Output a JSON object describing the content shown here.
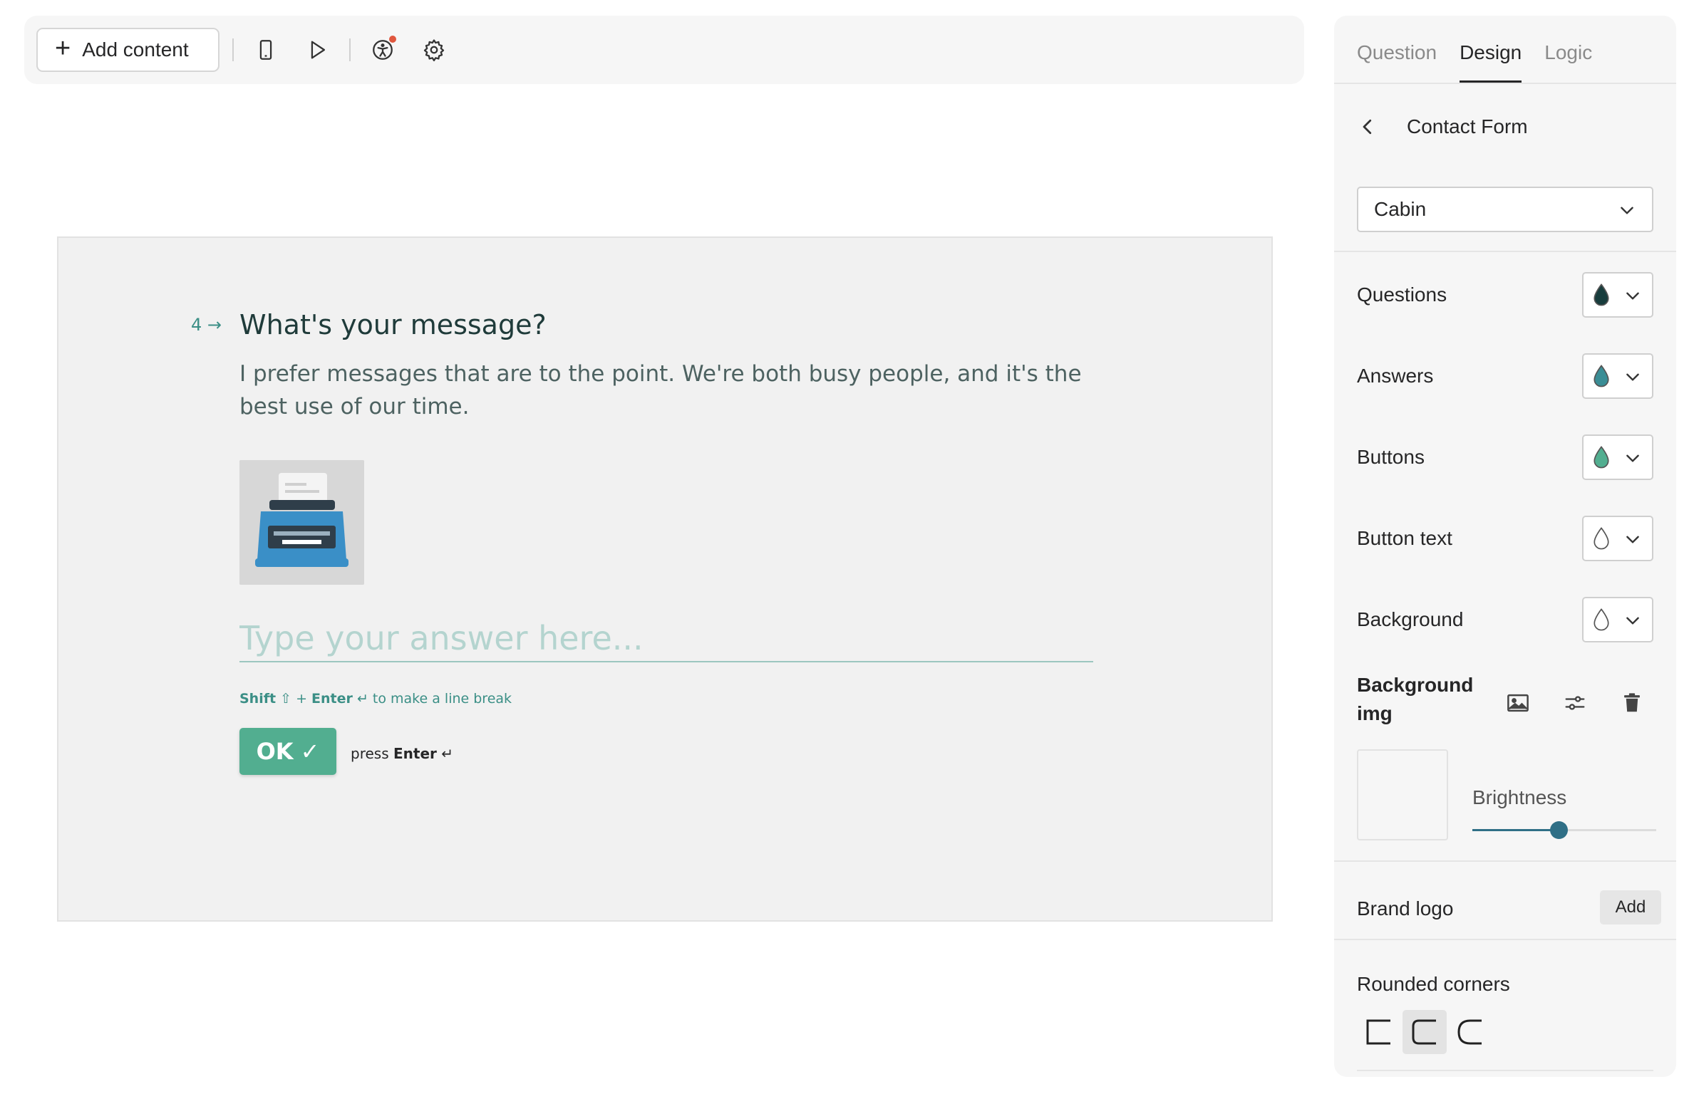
{
  "toolbar": {
    "add_content_label": "Add content",
    "icons": [
      "mobile-preview-icon",
      "play-icon",
      "accessibility-icon",
      "settings-icon"
    ]
  },
  "question": {
    "number": "4",
    "title": "What's your message?",
    "description": "I prefer messages that are to the point. We're both busy people, and it's the best use of our time.",
    "answer_placeholder": "Type your answer here...",
    "hint": {
      "shift": "Shift",
      "plus": "+",
      "enter": "Enter",
      "text": "to make a line break"
    },
    "ok_label": "OK",
    "press": "press",
    "enter": "Enter"
  },
  "panel": {
    "tabs": [
      "Question",
      "Design",
      "Logic"
    ],
    "active_tab": "Design",
    "title": "Contact Form",
    "theme": "Cabin",
    "colors": [
      {
        "label": "Questions",
        "color": "#173c3c"
      },
      {
        "label": "Answers",
        "color": "#3a8d95"
      },
      {
        "label": "Buttons",
        "color": "#52ae90"
      },
      {
        "label": "Button text",
        "color": "#ffffff"
      },
      {
        "label": "Background",
        "color": "#ffffff"
      }
    ],
    "background_img_label": "Background img",
    "brightness_label": "Brightness",
    "brightness_value": 0.47,
    "brand_logo_label": "Brand logo",
    "brand_logo_add": "Add",
    "rounded_corners_label": "Rounded corners",
    "rounded_corners_selected": 1
  }
}
